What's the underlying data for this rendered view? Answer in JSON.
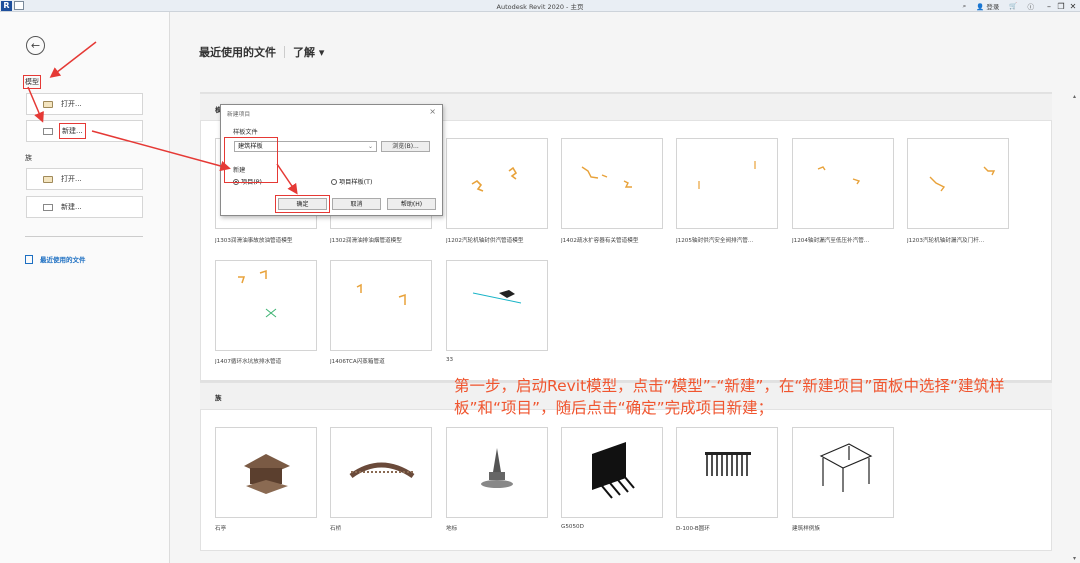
{
  "window": {
    "title": "Autodesk Revit 2020 - 主页",
    "logo": "R",
    "signin": "登录",
    "help": "?",
    "search_icon": "binoculars-icon",
    "cart_icon": "cart-icon"
  },
  "sidebar": {
    "model_label": "模型",
    "model_open": "打开...",
    "model_new": "新建...",
    "family_label": "族",
    "family_open": "打开...",
    "family_new": "新建...",
    "recent_files": "最近使用的文件"
  },
  "header": {
    "title": "最近使用的文件",
    "learn": "了解"
  },
  "models_section": {
    "title": "模型",
    "items": [
      {
        "label": "J1303润滑油事故放油管道模型"
      },
      {
        "label": "J1302润滑油排油烟管道模型"
      },
      {
        "label": "J1202汽轮机轴封供汽管道模型"
      },
      {
        "label": "J1402疏水扩容器有关管道模型"
      },
      {
        "label": "J1205轴封供汽安全阀排汽管..."
      },
      {
        "label": "J1204轴封漏汽至低压补汽管..."
      },
      {
        "label": "J1203汽轮机轴封漏汽及门杆..."
      },
      {
        "label": "J1407循环水坑放排水管道"
      },
      {
        "label": "J1406TCA闪蒸箱管道"
      },
      {
        "label": "33"
      }
    ]
  },
  "families_section": {
    "title": "族",
    "items": [
      {
        "label": "石亭"
      },
      {
        "label": "石桥"
      },
      {
        "label": "地标"
      },
      {
        "label": "G5050D"
      },
      {
        "label": "D-100-B圆环"
      },
      {
        "label": "建筑样例族"
      }
    ]
  },
  "dialog": {
    "title": "新建项目",
    "template_group": "样板文件",
    "template_value": "建筑样板",
    "browse": "浏览(B)...",
    "new_group": "新建",
    "radio_project": "项目(P)",
    "radio_template": "项目样板(T)",
    "ok": "确定",
    "cancel": "取消",
    "help": "帮助(H)"
  },
  "annotation": "第一步，启动Revit模型，点击“模型”-“新建”，在“新建项目”面板中选择“建筑样板”和“项目”，随后点击“确定”完成项目新建；",
  "colors": {
    "accent_red": "#e53935",
    "annotation": "#f0552f",
    "link_blue": "#1d6fc2",
    "drawing_orange": "#e8a23a"
  }
}
